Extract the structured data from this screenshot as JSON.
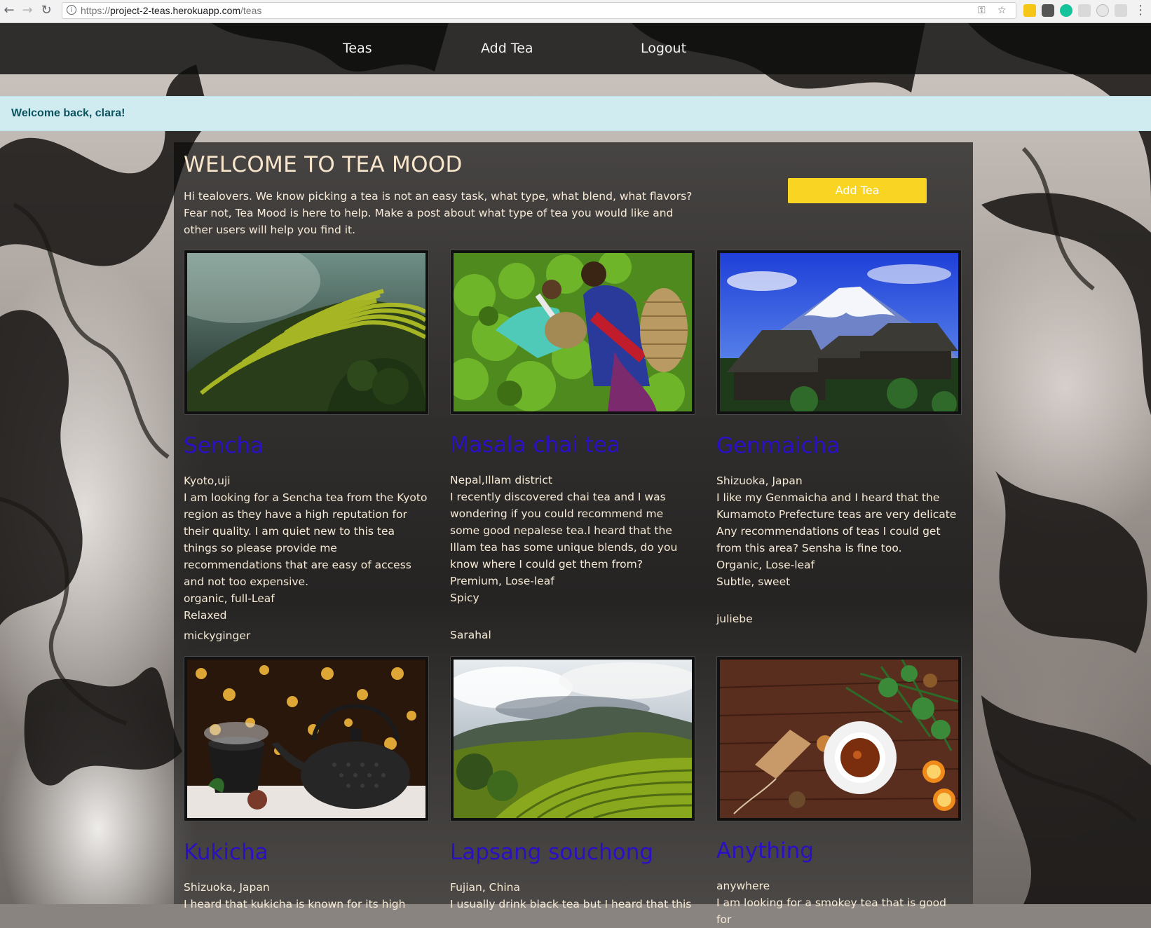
{
  "browser": {
    "url_protocol": "https://",
    "url_host": "project-2-teas.herokuapp.com",
    "url_path": "/teas"
  },
  "nav": {
    "teas": "Teas",
    "add_tea": "Add Tea",
    "logout": "Logout"
  },
  "alert": {
    "message": "Welcome back, clara!"
  },
  "hero": {
    "title": "WELCOME TO TEA MOOD",
    "text": "Hi tealovers. We know picking a tea is not an easy task, what type, what blend, what flavors? Fear not, Tea Mood is here to help. Make a post about what type of tea you would like and other users will help you find it.",
    "button": "Add Tea"
  },
  "teas": [
    {
      "title": "Sencha",
      "origin": "Kyoto,uji",
      "description": "I am looking for a Sencha tea from the Kyoto region as they have a high reputation for their quality. I am quiet new to this tea things so please provide me recommendations that are easy of access and not too expensive.",
      "type": "organic, full-Leaf",
      "mood": "Relaxed",
      "user": "mickyginger",
      "image": "terraced-rice-fields"
    },
    {
      "title": "Masala chai tea",
      "origin": "Nepal,Illam district",
      "description": "I recently discovered chai tea and I was wondering if you could recommend me some good nepalese tea.I heard that the Illam tea has some unique blends, do you know where I could get them from?",
      "type": "Premium, Lose-leaf",
      "mood": "Spicy",
      "user": "Sarahal",
      "image": "tea-pickers"
    },
    {
      "title": "Genmaicha",
      "origin": "Shizuoka, Japan",
      "description": "I like my Genmaicha and I heard that the Kumamoto Prefecture teas are very delicate Any recommendations of teas I could get from this area? Sensha is fine too.",
      "type": "Organic, Lose-leaf",
      "mood": "Subtle, sweet",
      "user": "juliebe",
      "image": "mount-fuji-village"
    },
    {
      "title": "Kukicha",
      "origin": "Shizuoka, Japan",
      "description": "I heard that kukicha is known for its high",
      "type": "",
      "mood": "",
      "user": "",
      "image": "cast-iron-teapot"
    },
    {
      "title": "Lapsang souchong",
      "origin": "Fujian, China",
      "description": "I usually drink black tea but I heard that this",
      "type": "",
      "mood": "",
      "user": "",
      "image": "tea-plantation-hills"
    },
    {
      "title": "Anything",
      "origin": "anywhere",
      "description": "I am looking for a smokey tea that is good for",
      "type": "",
      "mood": "",
      "user": "",
      "image": "tea-cup-on-wood"
    }
  ]
}
